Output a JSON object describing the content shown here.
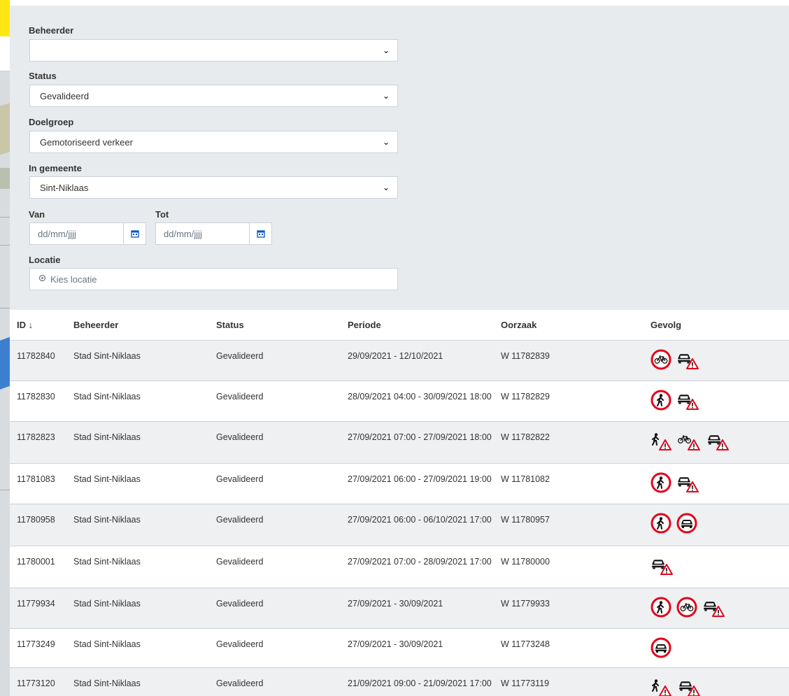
{
  "filters": {
    "beheerder": {
      "label": "Beheerder",
      "value": ""
    },
    "status": {
      "label": "Status",
      "value": "Gevalideerd"
    },
    "doelgroep": {
      "label": "Doelgroep",
      "value": "Gemotoriseerd verkeer"
    },
    "gemeente": {
      "label": "In gemeente",
      "value": "Sint-Niklaas"
    },
    "van": {
      "label": "Van",
      "placeholder": "dd/mm/jjjj"
    },
    "tot": {
      "label": "Tot",
      "placeholder": "dd/mm/jjjj"
    },
    "locatie": {
      "label": "Locatie",
      "placeholder": "Kies locatie"
    }
  },
  "table": {
    "headers": {
      "id": "ID ↓",
      "beheerder": "Beheerder",
      "status": "Status",
      "periode": "Periode",
      "oorzaak": "Oorzaak",
      "gevolg": "Gevolg"
    },
    "rows": [
      {
        "id": "11782840",
        "beheerder": "Stad Sint-Niklaas",
        "status": "Gevalideerd",
        "periode": "29/09/2021 - 12/10/2021",
        "oorzaak": "W 11782839",
        "gevolg": [
          "no-bicycles-sign-icon",
          "car-warning-sign-icon"
        ]
      },
      {
        "id": "11782830",
        "beheerder": "Stad Sint-Niklaas",
        "status": "Gevalideerd",
        "periode": "28/09/2021 04:00 - 30/09/2021 18:00",
        "oorzaak": "W 11782829",
        "gevolg": [
          "no-pedestrians-sign-icon",
          "car-warning-sign-icon"
        ]
      },
      {
        "id": "11782823",
        "beheerder": "Stad Sint-Niklaas",
        "status": "Gevalideerd",
        "periode": "27/09/2021 07:00 - 27/09/2021 18:00",
        "oorzaak": "W 11782822",
        "gevolg": [
          "pedestrian-warning-sign-icon",
          "bicycle-warning-sign-icon",
          "car-warning-sign-icon"
        ]
      },
      {
        "id": "11781083",
        "beheerder": "Stad Sint-Niklaas",
        "status": "Gevalideerd",
        "periode": "27/09/2021 06:00 - 27/09/2021 19:00",
        "oorzaak": "W 11781082",
        "gevolg": [
          "no-pedestrians-sign-icon",
          "car-warning-sign-icon"
        ]
      },
      {
        "id": "11780958",
        "beheerder": "Stad Sint-Niklaas",
        "status": "Gevalideerd",
        "periode": "27/09/2021 06:00 - 06/10/2021 17:00",
        "oorzaak": "W 11780957",
        "gevolg": [
          "no-pedestrians-sign-icon",
          "no-cars-sign-icon"
        ]
      },
      {
        "id": "11780001",
        "beheerder": "Stad Sint-Niklaas",
        "status": "Gevalideerd",
        "periode": "27/09/2021 07:00 - 28/09/2021 17:00",
        "oorzaak": "W 11780000",
        "gevolg": [
          "car-warning-sign-icon"
        ]
      },
      {
        "id": "11779934",
        "beheerder": "Stad Sint-Niklaas",
        "status": "Gevalideerd",
        "periode": "27/09/2021 - 30/09/2021",
        "oorzaak": "W 11779933",
        "gevolg": [
          "no-pedestrians-sign-icon",
          "no-bicycles-sign-icon",
          "car-warning-sign-icon"
        ]
      },
      {
        "id": "11773249",
        "beheerder": "Stad Sint-Niklaas",
        "status": "Gevalideerd",
        "periode": "27/09/2021 - 30/09/2021",
        "oorzaak": "W 11773248",
        "gevolg": [
          "no-cars-sign-icon"
        ]
      },
      {
        "id": "11773120",
        "beheerder": "Stad Sint-Niklaas",
        "status": "Gevalideerd",
        "periode": "21/09/2021 09:00 - 21/09/2021 17:00",
        "oorzaak": "W 11773119",
        "gevolg": [
          "pedestrian-warning-sign-icon",
          "car-warning-sign-icon"
        ]
      }
    ]
  },
  "colors": {
    "sign_red": "#e3051b",
    "panel_bg": "#e8ebee",
    "stripe_bg": "#eef0f2",
    "accent_blue": "#0055cc"
  }
}
